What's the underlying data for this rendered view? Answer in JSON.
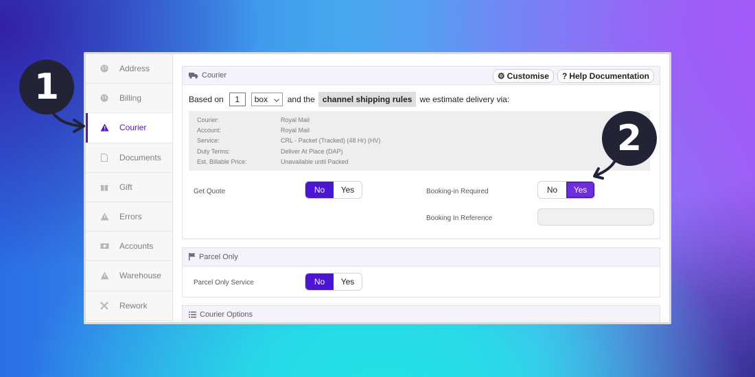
{
  "sidebar": {
    "items": [
      {
        "label": "Address",
        "icon": "globe-icon"
      },
      {
        "label": "Billing",
        "icon": "globe-icon"
      },
      {
        "label": "Courier",
        "icon": "warning-icon",
        "active": true
      },
      {
        "label": "Documents",
        "icon": "document-icon"
      },
      {
        "label": "Gift",
        "icon": "gift-icon"
      },
      {
        "label": "Errors",
        "icon": "warning-icon"
      },
      {
        "label": "Accounts",
        "icon": "money-icon"
      },
      {
        "label": "Warehouse",
        "icon": "warning-icon"
      },
      {
        "label": "Rework",
        "icon": "tools-icon"
      }
    ]
  },
  "courier_panel": {
    "title": "Courier",
    "customise_label": "Customise",
    "help_label": "Help Documentation",
    "based_on": "Based on",
    "quantity": "1",
    "unit": "box",
    "and_the": "and the",
    "rules_label": "channel shipping rules",
    "estimate_text": "we estimate delivery via:",
    "info": [
      {
        "key": "Courier:",
        "value": "Royal Mail"
      },
      {
        "key": "Account:",
        "value": "Royal Mail"
      },
      {
        "key": "Service:",
        "value": "CRL - Packet (Tracked) (48 Hr) (HV)"
      },
      {
        "key": "Duty Terms:",
        "value": "Deliver At Place (DAP)"
      },
      {
        "key": "Est. Billable Price:",
        "value": "Unavailable until Packed"
      }
    ],
    "get_quote_label": "Get Quote",
    "get_quote_selected": "No",
    "booking_label": "Booking-in Required",
    "booking_selected": "Yes",
    "booking_ref_label": "Booking In Reference",
    "booking_ref_value": ""
  },
  "toggle_labels": {
    "no": "No",
    "yes": "Yes"
  },
  "parcel_panel": {
    "title": "Parcel Only",
    "service_label": "Parcel Only Service",
    "service_selected": "No"
  },
  "options_panel": {
    "title": "Courier Options"
  },
  "badges": {
    "one": "1",
    "two": "2"
  },
  "colors": {
    "accent": "#4c14d4",
    "badge": "#232336"
  }
}
